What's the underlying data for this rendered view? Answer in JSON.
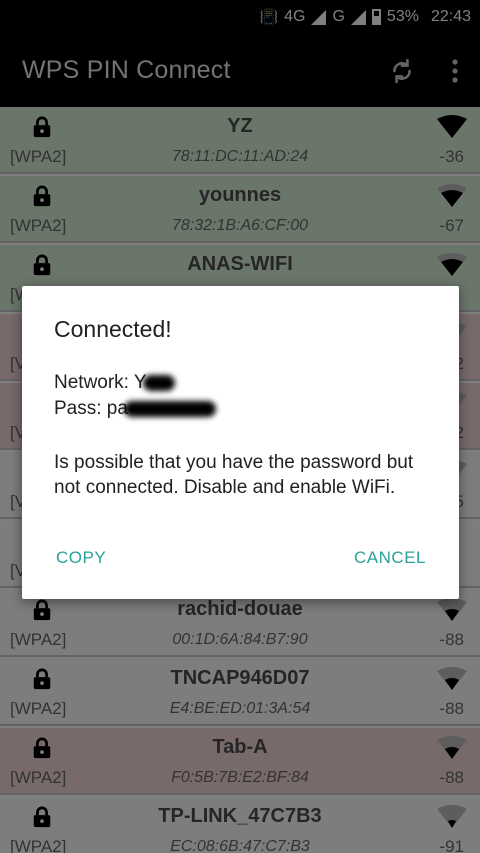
{
  "status_bar": {
    "network_4g": "4G",
    "network_g": "G",
    "battery": "53%",
    "time": "22:43"
  },
  "app_bar": {
    "title": "WPS PIN Connect",
    "refresh_icon": "refresh-icon",
    "menu_icon": "overflow-menu-icon"
  },
  "networks": [
    {
      "ssid": "YZ",
      "security": "[WPA2]",
      "mac": "78:11:DC:11:AD:24",
      "rssi": "-36",
      "status": "green"
    },
    {
      "ssid": "younnes",
      "security": "[WPA2]",
      "mac": "78:32:1B:A6:CF:00",
      "rssi": "-67",
      "status": "green"
    },
    {
      "ssid": "ANAS-WIFI",
      "security": "[W",
      "mac": "",
      "rssi": "",
      "status": "green"
    },
    {
      "ssid": "",
      "security": "[V",
      "mac": "",
      "rssi": "2",
      "status": "red"
    },
    {
      "ssid": "",
      "security": "[V",
      "mac": "",
      "rssi": "2",
      "status": "red"
    },
    {
      "ssid": "",
      "security": "[V",
      "mac": "",
      "rssi": "5",
      "status": "white"
    },
    {
      "ssid": "",
      "security": "[V",
      "mac": "",
      "rssi": "",
      "status": "white"
    },
    {
      "ssid": "rachid-douae",
      "security": "[WPA2]",
      "mac": "00:1D:6A:84:B7:90",
      "rssi": "-88",
      "status": "white"
    },
    {
      "ssid": "TNCAP946D07",
      "security": "[WPA2]",
      "mac": "E4:BE:ED:01:3A:54",
      "rssi": "-88",
      "status": "white"
    },
    {
      "ssid": "Tab-A",
      "security": "[WPA2]",
      "mac": "F0:5B:7B:E2:BF:84",
      "rssi": "-88",
      "status": "red"
    },
    {
      "ssid": "TP-LINK_47C7B3",
      "security": "[WPA2]",
      "mac": "EC:08:6B:47:C7:B3",
      "rssi": "-91",
      "status": "white"
    }
  ],
  "dialog": {
    "title": "Connected!",
    "network_label": "Network: Y",
    "pass_label": "Pass: pa",
    "message": "Is possible that you have the password but not connected. Disable and enable WiFi.",
    "copy_label": "COPY",
    "cancel_label": "CANCEL"
  },
  "colors": {
    "connected_row": "#d7ecd4",
    "failed_row": "#f0d4d4",
    "accent": "#2aa198",
    "appbar": "#000000"
  }
}
